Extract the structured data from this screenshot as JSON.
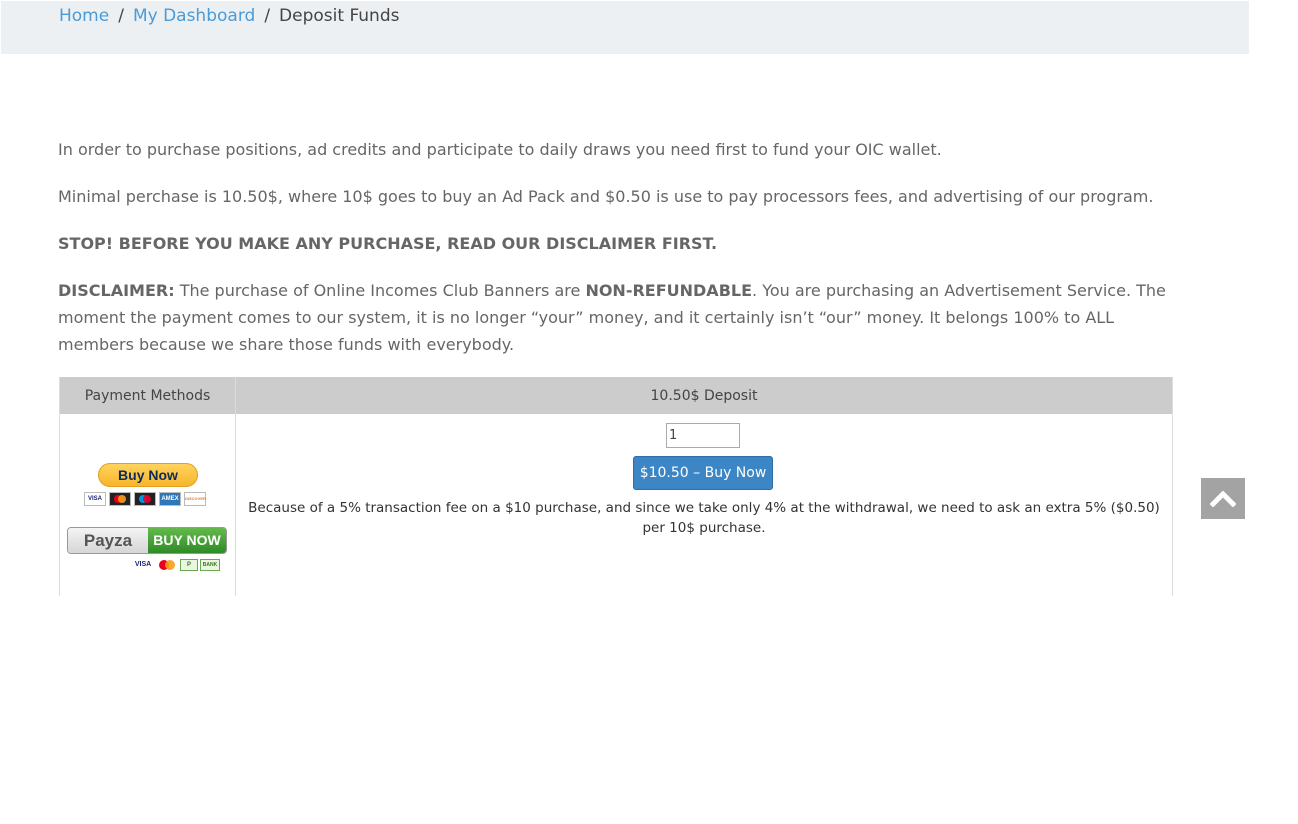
{
  "breadcrumb": {
    "home": "Home",
    "separator": "/",
    "dashboard": "My Dashboard",
    "current": "Deposit Funds"
  },
  "content": {
    "intro": "In order to purchase positions, ad credits and participate to daily draws you need first to fund your OIC wallet.",
    "minimal": "Minimal perchase is 10.50$, where 10$ goes to buy an Ad Pack and $0.50 is use to pay processors fees, and advertising of our program.",
    "stop_notice": "STOP! BEFORE YOU MAKE ANY PURCHASE, READ OUR DISCLAIMER FIRST.",
    "disclaimer_label": "DISCLAIMER:",
    "disclaimer_part1": " The purchase of Online Incomes Club Banners are ",
    "disclaimer_bold": "NON-REFUNDABLE",
    "disclaimer_part2": ". You are purchasing an Advertisement Service. The moment the payment comes to our system, it is no longer “your” money, and it certainly isn’t “our” money. It belongs 100% to ALL members because we share those funds with everybody."
  },
  "table": {
    "header_methods": "Payment Methods",
    "header_deposit": "10.50$ Deposit",
    "paypal_label": "Buy Now",
    "paypal_cards": [
      "VISA",
      "MC",
      "MAESTRO",
      "AMEX",
      "DISCOVER"
    ],
    "payza_brand": "Payza",
    "payza_action": "BUY NOW",
    "payza_cards": [
      "VISA",
      "MC",
      "P",
      "BANK"
    ],
    "quantity_value": "1",
    "buy_button": "$10.50 – Buy Now",
    "fee_note": "Because of a 5% transaction fee on a $10 purchase, and since we take only 4% at the withdrawal, we need to ask an extra 5% ($0.50) per 10$ purchase."
  },
  "icons": {
    "scroll_top": "chevron-up-icon"
  },
  "colors": {
    "link": "#4a9bd6",
    "primary_button": "#3c86c5",
    "table_header": "#cccccc",
    "breadcrumb_bg": "#ecf0f3",
    "scroll_top_bg": "#a3a3a3"
  }
}
